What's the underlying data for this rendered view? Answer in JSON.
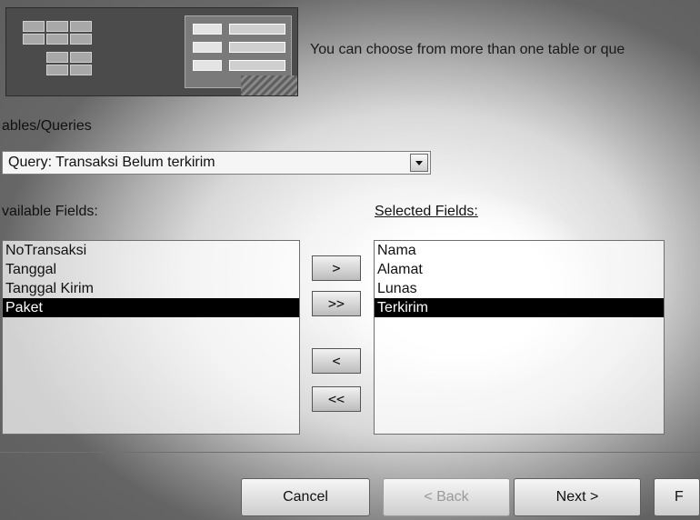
{
  "intro_text": "You can choose from more than one table or que",
  "source": {
    "label": "Tables/Queries",
    "label_visible": "ables/Queries",
    "selected": "Query: Transaksi Belum terkirim",
    "selected_visible": "Query: Transaksi Belum terkirim"
  },
  "available": {
    "label_visible": "vailable Fields:",
    "items": [
      "NoTransaksi",
      "Tanggal",
      "Tanggal Kirim",
      "Paket"
    ],
    "selected_index": 3
  },
  "selected_fields": {
    "label": "Selected Fields:",
    "items": [
      "Nama",
      "Alamat",
      "Lunas",
      "Terkirim"
    ],
    "selected_index": 3
  },
  "move_buttons": {
    "add_one": ">",
    "add_all": ">>",
    "remove_one": "<",
    "remove_all": "<<"
  },
  "buttons": {
    "cancel": "Cancel",
    "back": "< Back",
    "next": "Next >",
    "finish_partial": "F"
  },
  "colors": {
    "selection_bg": "#000000",
    "selection_fg": "#ffffff"
  }
}
